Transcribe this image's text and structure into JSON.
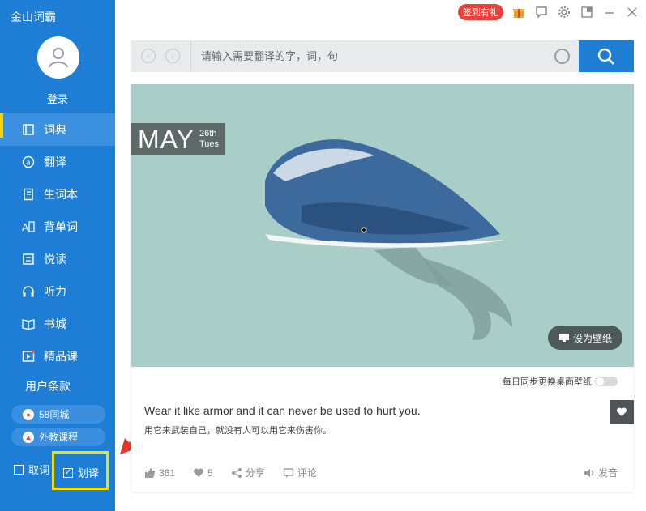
{
  "app": {
    "title": "金山词霸"
  },
  "user": {
    "login_label": "登录"
  },
  "colors": {
    "sidebar": "#1e7ed6",
    "accent": "#1e7ed6",
    "badge": "#e8433a",
    "highlight": "#f5e100"
  },
  "sidebar": {
    "items": [
      {
        "label": "词典",
        "icon": "dictionary-icon"
      },
      {
        "label": "翻译",
        "icon": "translate-icon"
      },
      {
        "label": "生词本",
        "icon": "vocabulary-book-icon"
      },
      {
        "label": "背单词",
        "icon": "memorize-icon"
      },
      {
        "label": "悦读",
        "icon": "reading-icon"
      },
      {
        "label": "听力",
        "icon": "headphones-icon"
      },
      {
        "label": "书城",
        "icon": "bookstore-icon"
      },
      {
        "label": "精品课",
        "icon": "course-icon"
      }
    ],
    "terms_label": "用户条款",
    "promo": [
      {
        "label": "58同城",
        "icon": "58-icon"
      },
      {
        "label": "外教课程",
        "icon": "flame-icon"
      }
    ],
    "cancel_label": "取词",
    "highlight_label": "划译"
  },
  "header": {
    "signin_badge": "签到有礼"
  },
  "search": {
    "placeholder": "请输入需要翻译的字，词，句"
  },
  "daily": {
    "month": "MAY",
    "day": "26th",
    "weekday": "Tues",
    "wallpaper_button": "设为壁纸",
    "sync_label": "每日同步更换桌面壁纸",
    "quote_en": "Wear it like armor and it can never be used to hurt you.",
    "quote_cn": "用它来武装自己，就没有人可以用它来伤害你。",
    "likes": "361",
    "hearts": "5",
    "share_label": "分享",
    "comment_label": "评论",
    "speak_label": "发音"
  }
}
